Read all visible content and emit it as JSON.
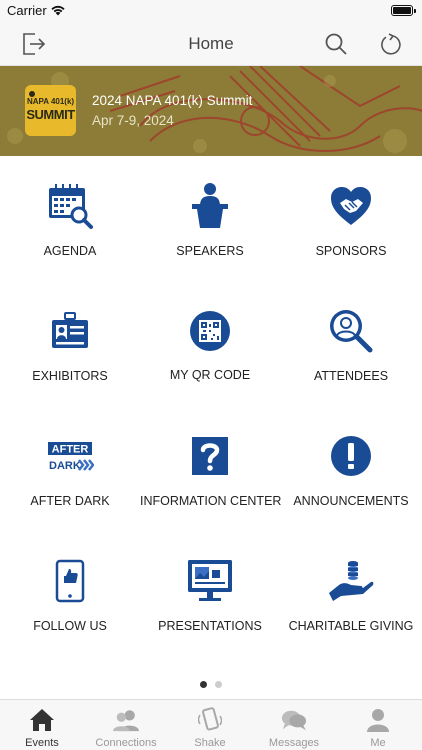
{
  "status_bar": {
    "carrier": "Carrier"
  },
  "nav": {
    "title": "Home"
  },
  "event": {
    "logo_line1": "NAPA 401(k)",
    "logo_line2": "SUMMIT",
    "title": "2024 NAPA 401(k) Summit",
    "date": "Apr 7-9, 2024"
  },
  "tiles": [
    {
      "label": "AGENDA",
      "icon": "calendar-search-icon"
    },
    {
      "label": "SPEAKERS",
      "icon": "podium-speaker-icon"
    },
    {
      "label": "SPONSORS",
      "icon": "heart-handshake-icon"
    },
    {
      "label": "EXHIBITORS",
      "icon": "badge-id-icon"
    },
    {
      "label": "MY QR CODE",
      "icon": "qr-code-icon"
    },
    {
      "label": "ATTENDEES",
      "icon": "person-search-icon"
    },
    {
      "label": "AFTER DARK",
      "icon": "after-dark-logo-icon"
    },
    {
      "label": "INFORMATION CENTER",
      "icon": "question-mark-icon"
    },
    {
      "label": "ANNOUNCEMENTS",
      "icon": "exclamation-icon"
    },
    {
      "label": "FOLLOW US",
      "icon": "phone-like-icon"
    },
    {
      "label": "PRESENTATIONS",
      "icon": "presentation-monitor-icon"
    },
    {
      "label": "CHARITABLE GIVING",
      "icon": "hand-coins-icon"
    }
  ],
  "after_dark": {
    "line1": "AFTER",
    "line2": "DARK"
  },
  "pager": {
    "pages": 2,
    "current": 1
  },
  "tab_bar": [
    {
      "label": "Events",
      "icon": "home-icon",
      "active": true
    },
    {
      "label": "Connections",
      "icon": "people-icon",
      "active": false
    },
    {
      "label": "Shake",
      "icon": "shake-phone-icon",
      "active": false
    },
    {
      "label": "Messages",
      "icon": "chat-bubbles-icon",
      "active": false
    },
    {
      "label": "Me",
      "icon": "person-icon",
      "active": false
    }
  ],
  "colors": {
    "icon_blue": "#1a4b95",
    "banner": "#8f7d38",
    "active_tab": "#333333",
    "inactive_tab": "#999999"
  }
}
